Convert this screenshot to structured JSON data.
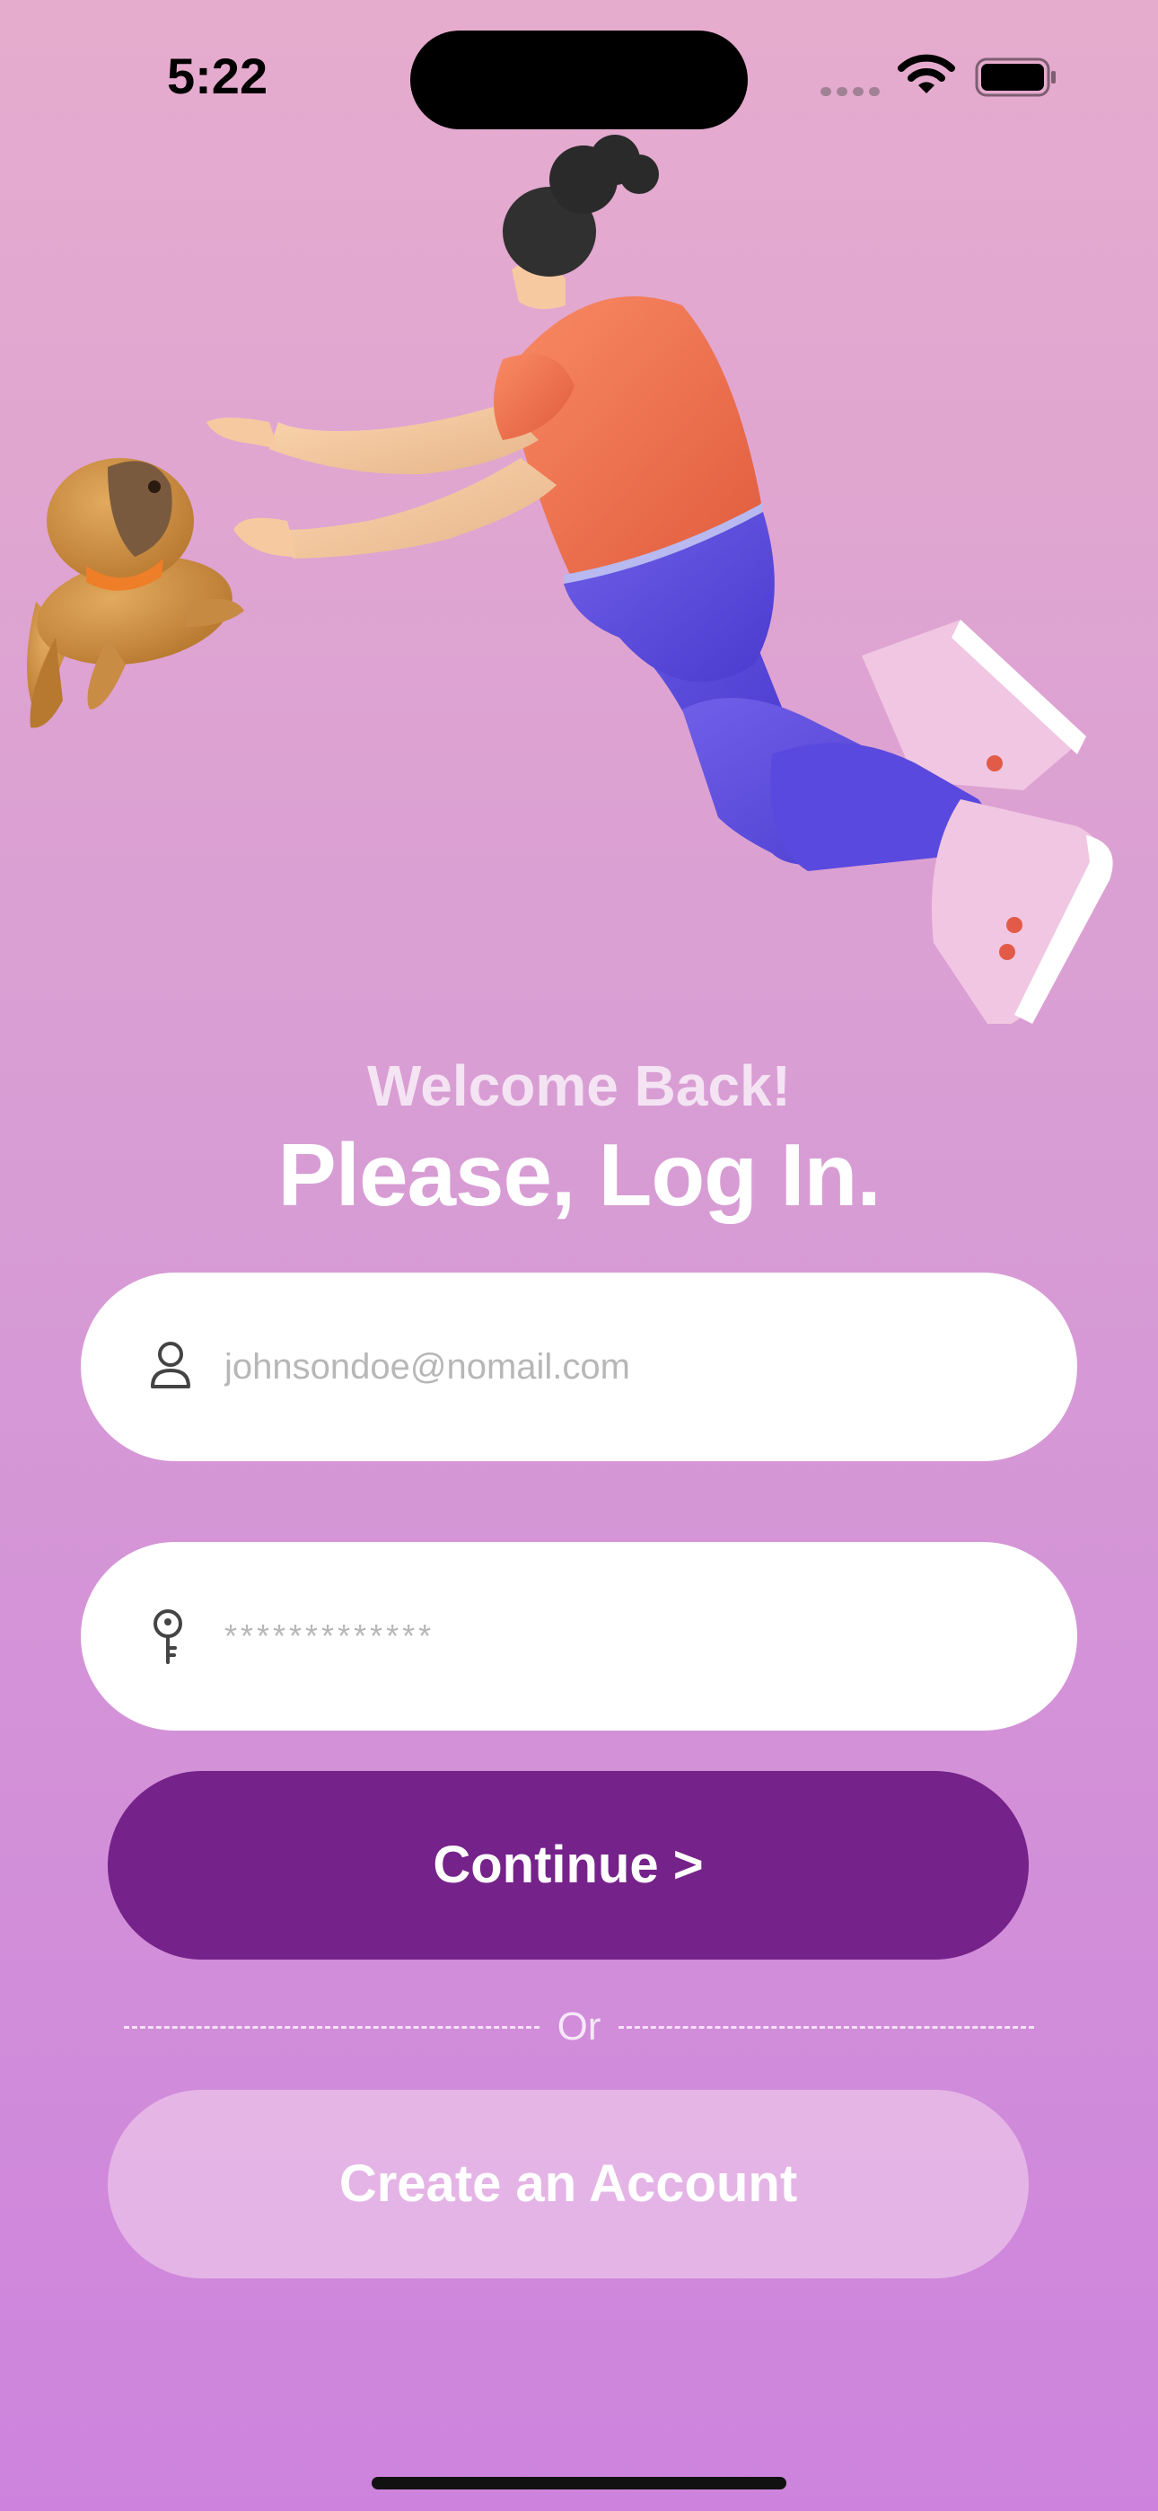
{
  "status_bar": {
    "time": "5:22",
    "icons": [
      "cellular-signal-icon",
      "wifi-icon",
      "battery-icon"
    ]
  },
  "hero": {
    "illustration": "person-leaping-toward-puppy",
    "icons": [
      "dog-figure",
      "person-figure"
    ]
  },
  "header": {
    "welcome": "Welcome Back!",
    "title": "Please, Log In."
  },
  "form": {
    "email": {
      "placeholder": "johnsondoe@nomail.com",
      "value": "",
      "icon": "user-icon"
    },
    "password": {
      "placeholder": "*************",
      "value": "",
      "icon": "key-icon"
    },
    "continue_label": "Continue >",
    "divider_label": "Or",
    "create_label": "Create an Account"
  },
  "colors": {
    "primary_button": "#75228a",
    "secondary_button": "#eabfe9",
    "background_top": "#e6acce",
    "background_bottom": "#cd83dd"
  }
}
